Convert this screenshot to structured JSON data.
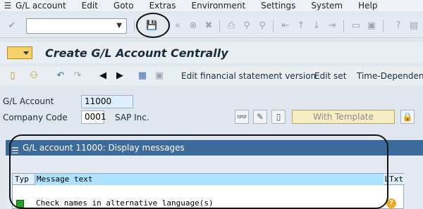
{
  "menubar": {
    "items": [
      "G/L account",
      "Edit",
      "Goto",
      "Extras",
      "Environment",
      "Settings",
      "System",
      "Help"
    ]
  },
  "toolbar": {
    "command_field_value": ""
  },
  "title": "Create G/L Account Centrally",
  "app_toolbar": {
    "buttons": [
      "Edit financial statement version",
      "Edit set",
      "Time-Dependent"
    ]
  },
  "form": {
    "gl_account_label": "G/L Account",
    "gl_account_value": "11000",
    "company_code_label": "Company Code",
    "company_code_value": "0001",
    "company_name": "SAP Inc.",
    "with_template_label": "With Template"
  },
  "messages": {
    "window_title": "G/L account 11000: Display messages",
    "columns": {
      "typ": "Typ",
      "message": "Message text",
      "ltxt": "LTxt"
    },
    "rows": [
      {
        "status_color": "#1fa51f",
        "text": "Check names in alternative language(s)"
      }
    ]
  }
}
